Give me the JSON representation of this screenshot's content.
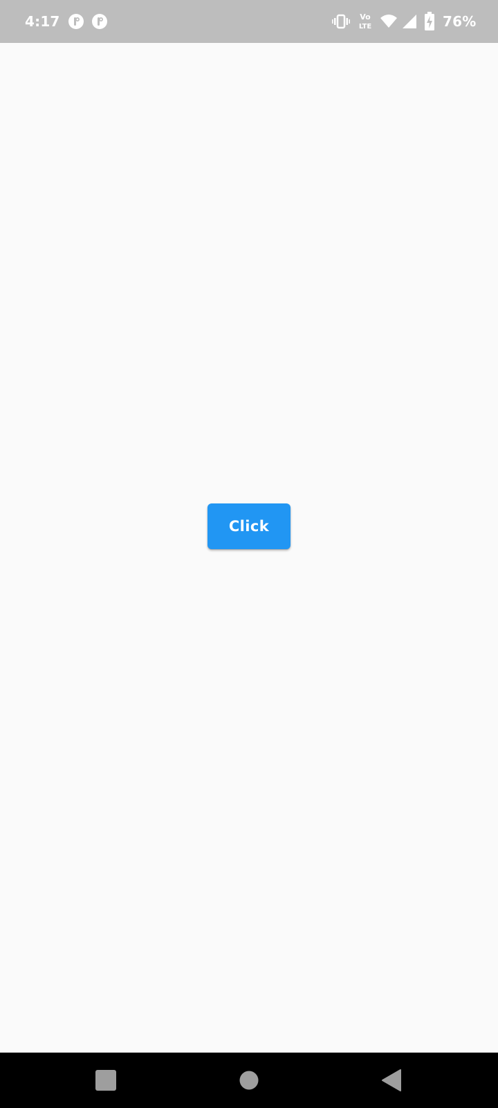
{
  "status_bar": {
    "time": "4:17",
    "battery_percent": "76%",
    "icons": {
      "notification_1": "pinterest-icon",
      "notification_2": "pinterest-icon",
      "vibrate": "vibrate-icon",
      "volte": "volte-icon",
      "wifi": "wifi-icon",
      "signal": "signal-icon",
      "battery": "battery-charging-icon"
    },
    "volte_text": {
      "top": "Vo",
      "bottom": "LTE"
    },
    "background_color": "#bdbdbd"
  },
  "main": {
    "button_label": "Click",
    "button_color": "#2196f3",
    "background_color": "#fafafa"
  },
  "nav_bar": {
    "items": [
      {
        "icon": "recents-icon"
      },
      {
        "icon": "home-icon"
      },
      {
        "icon": "back-icon"
      }
    ],
    "background_color": "#000000"
  }
}
